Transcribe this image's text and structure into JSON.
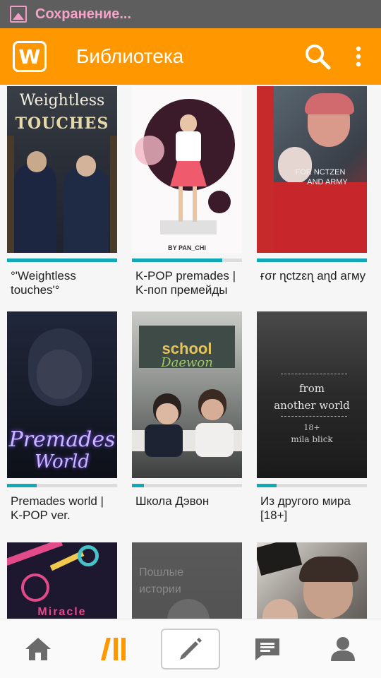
{
  "status_bar": {
    "text": "Сохранение..."
  },
  "app_bar": {
    "title": "Библиотека",
    "logo_letter": "W"
  },
  "library": [
    {
      "title": "°'Weightless touches'°",
      "progress": 1.0,
      "cover_text": [
        "Weightless",
        "TOUCHES"
      ]
    },
    {
      "title": "K-POP premades | K-поп премейды",
      "progress": 0.82,
      "cover_text": [
        "BY PAN_CHI"
      ]
    },
    {
      "title": "ғσr ɳctzɛɳ aɳd aгмy",
      "progress": 1.0,
      "cover_text": [
        "FOR NCTZEN",
        "AND ARMY"
      ]
    },
    {
      "title": "Premades world | K-POP ver.",
      "progress": 0.27,
      "cover_text": [
        "Premades",
        "World"
      ]
    },
    {
      "title": "Школа Дэвон",
      "progress": 0.11,
      "cover_text": [
        "school",
        "Daewon"
      ]
    },
    {
      "title": "Из другого мира [18+]",
      "progress": 0.18,
      "cover_text": [
        "from",
        "another world",
        "18+",
        "mila blick"
      ]
    },
    {
      "title": "",
      "progress": 0,
      "cover_text": [
        "Miracle"
      ]
    },
    {
      "title": "",
      "progress": 0,
      "cover_text": [
        "Пошлые",
        "истории"
      ]
    },
    {
      "title": "",
      "progress": 0,
      "cover_text": []
    }
  ],
  "bottom_nav": [
    {
      "name": "home-icon"
    },
    {
      "name": "library-icon",
      "active": true
    },
    {
      "name": "pencil-icon"
    },
    {
      "name": "messages-icon"
    },
    {
      "name": "profile-icon"
    }
  ],
  "colors": {
    "accent": "#ff9800",
    "progress": "#12a8b5",
    "status_bar": "#5e5e5e"
  }
}
